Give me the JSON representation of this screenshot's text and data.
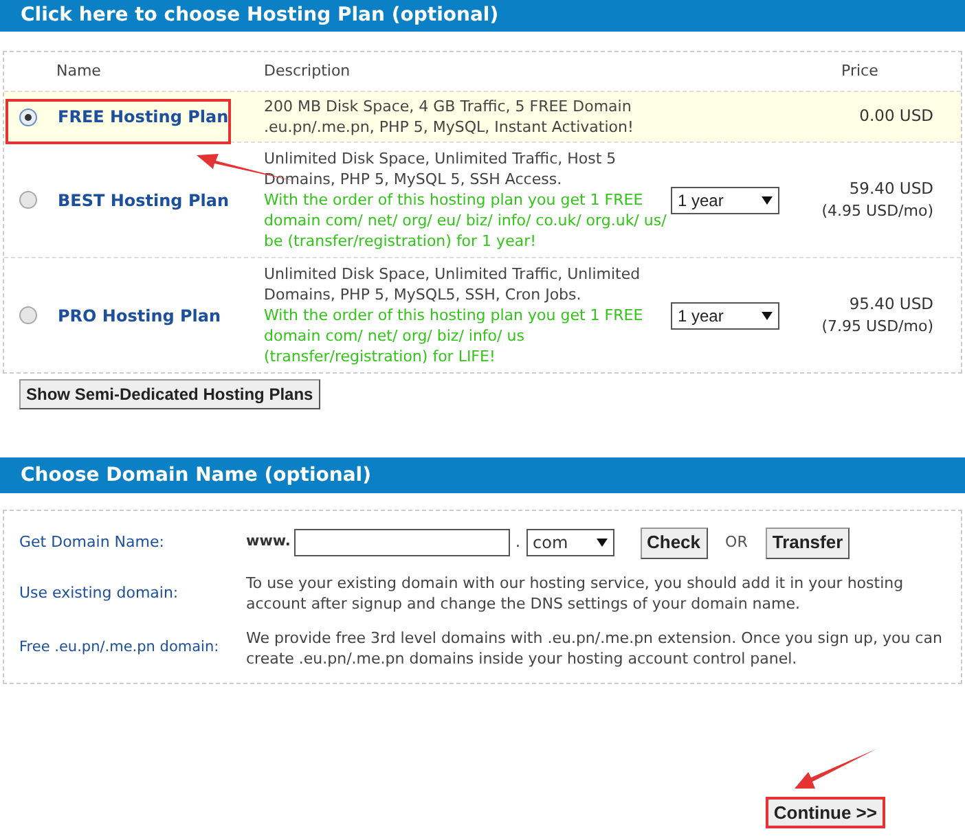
{
  "plan_section": {
    "title": "Click here to choose Hosting Plan (optional)",
    "columns": [
      "Name",
      "Description",
      "Price"
    ],
    "plans": [
      {
        "name": "FREE Hosting Plan",
        "selected": true,
        "description": "200 MB Disk Space, 4 GB Traffic, 5 FREE Domain .eu.pn/.me.pn, PHP 5, MySQL, Instant Activation!",
        "price": "0.00 USD"
      },
      {
        "name": "BEST Hosting Plan",
        "selected": false,
        "description": "Unlimited Disk Space, Unlimited Traffic, Host 5 Domains, PHP 5, MySQL 5, SSH Access.",
        "offer": "With the order of this hosting plan you get 1 FREE domain com/ net/ org/ eu/ biz/ info/ co.uk/ org.uk/ us/ be (transfer/registration) for 1 year!",
        "period": "1 year",
        "price": "59.40 USD",
        "monthly": "(4.95 USD/mo)"
      },
      {
        "name": "PRO Hosting Plan",
        "selected": false,
        "description": "Unlimited Disk Space, Unlimited Traffic, Unlimited Domains, PHP 5, MySQL5, SSH, Cron Jobs.",
        "offer": "With the order of this hosting plan you get 1 FREE domain com/ net/ org/ biz/ info/ us (transfer/registration) for LIFE!",
        "period": "1 year",
        "price": "95.40 USD",
        "monthly": "(7.95 USD/mo)"
      }
    ],
    "more_button": "Show Semi-Dedicated Hosting Plans"
  },
  "domain_section": {
    "title": "Choose Domain Name (optional)",
    "get_label": "Get Domain Name:",
    "prefix": "www.",
    "dot": ".",
    "tld": "com",
    "check_button": "Check",
    "or": "OR",
    "transfer_button": "Transfer",
    "existing_label": "Use existing domain:",
    "existing_text": "To use your existing domain with our hosting service, you should add it in your hosting account after signup and change the DNS settings of your domain name.",
    "free_label": "Free .eu.pn/.me.pn domain:",
    "free_text": "We provide free 3rd level domains with .eu.pn/.me.pn extension. Once you sign up, you can create .eu.pn/.me.pn domains inside your hosting account control panel."
  },
  "continue_button": "Continue >>"
}
